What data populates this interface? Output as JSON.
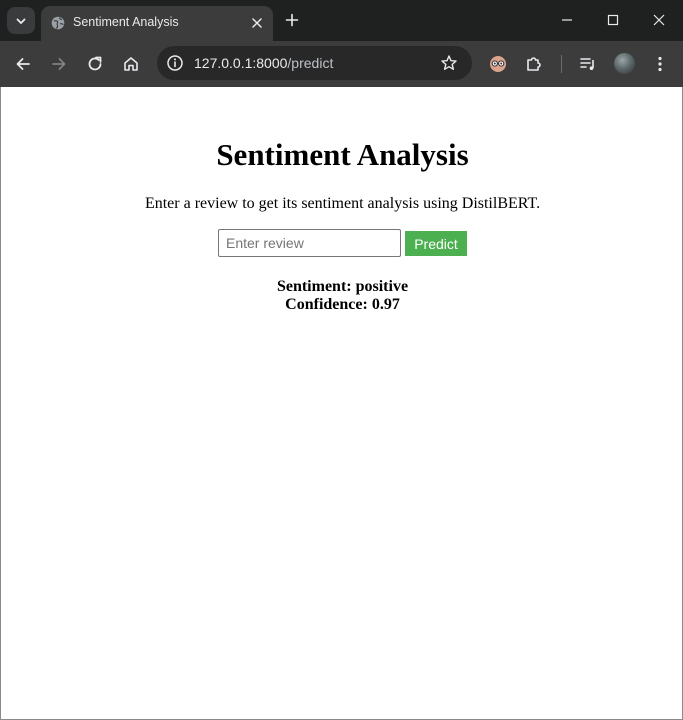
{
  "browser": {
    "tab": {
      "title": "Sentiment Analysis"
    },
    "address_bar": {
      "host": "127.0.0.1:8000",
      "path": "/predict"
    },
    "colors": {
      "chrome_dark": "#1f2020",
      "toolbar": "#3c3c3c",
      "omnibox": "#282828"
    }
  },
  "page": {
    "title": "Sentiment Analysis",
    "description": "Enter a review to get its sentiment analysis using DistilBERT.",
    "form": {
      "input_placeholder": "Enter review",
      "input_value": "",
      "submit_label": "Predict"
    },
    "result": {
      "sentiment_line": "Sentiment: positive",
      "confidence_line": "Confidence: 0.97"
    },
    "colors": {
      "predict_button": "#4caf50"
    }
  }
}
